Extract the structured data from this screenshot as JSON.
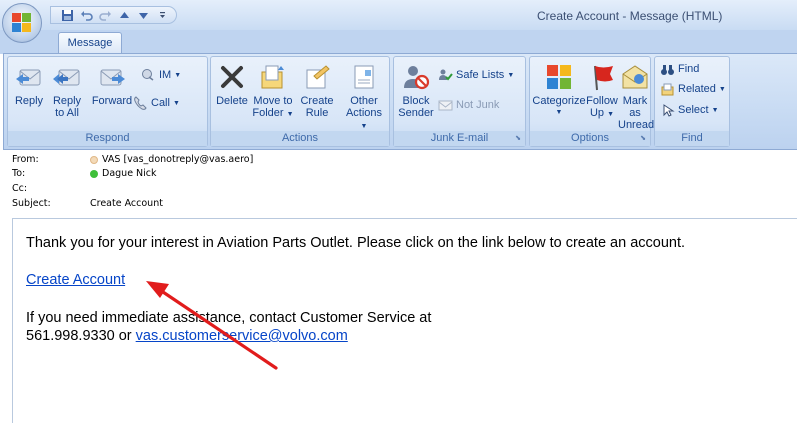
{
  "window": {
    "title": "Create Account - Message (HTML)"
  },
  "tabs": [
    {
      "label": "Message"
    }
  ],
  "ribbon": {
    "respond": {
      "label": "Respond",
      "reply": "Reply",
      "reply_all_line1": "Reply",
      "reply_all_line2": "to All",
      "forward": "Forward",
      "im": "IM",
      "call": "Call"
    },
    "actions": {
      "label": "Actions",
      "delete": "Delete",
      "move_line1": "Move to",
      "move_line2": "Folder",
      "create_rule_line1": "Create",
      "create_rule_line2": "Rule",
      "other_line1": "Other",
      "other_line2": "Actions"
    },
    "junk": {
      "label": "Junk E-mail",
      "block_line1": "Block",
      "block_line2": "Sender",
      "safe_lists": "Safe Lists",
      "not_junk": "Not Junk"
    },
    "options": {
      "label": "Options",
      "categorize": "Categorize",
      "follow_line1": "Follow",
      "follow_line2": "Up",
      "mark_line1": "Mark as",
      "mark_line2": "Unread"
    },
    "find": {
      "label": "Find",
      "find": "Find",
      "related": "Related",
      "select": "Select"
    }
  },
  "header": {
    "from_label": "From:",
    "from_value": "VAS [vas_donotreply@vas.aero]",
    "to_label": "To:",
    "to_value": "Dague Nick",
    "cc_label": "Cc:",
    "subject_label": "Subject:",
    "subject_value": "Create Account"
  },
  "body": {
    "intro": "Thank you for your interest in Aviation Parts Outlet. Please click on the link below to create an account.",
    "link_text": "Create Account",
    "help_line1": "If you need immediate assistance, contact Customer Service at",
    "help_phone": "561.998.9330 or ",
    "help_email": "vas.customerservice@volvo.com"
  },
  "colors": {
    "ribbon_text": "#15428b",
    "link": "#0645c8",
    "annotation_arrow": "#e11c1c"
  }
}
